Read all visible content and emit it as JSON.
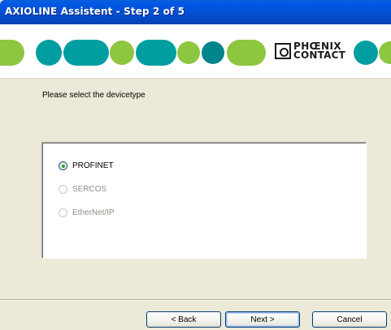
{
  "window": {
    "title": "AXIOLINE Assistent - Step 2 of 5"
  },
  "banner": {
    "logo_line1": "PHŒNIX",
    "logo_line2": "CONTACT",
    "colors": {
      "green": "#8dc63f",
      "teal": "#009ea1",
      "dark_teal": "#00868a"
    }
  },
  "content": {
    "prompt": "Please select the devicetype",
    "device_types": [
      {
        "label": "PROFINET",
        "selected": true,
        "enabled": true
      },
      {
        "label": "SERCOS",
        "selected": false,
        "enabled": false
      },
      {
        "label": "EtherNet/IP",
        "selected": false,
        "enabled": false
      }
    ]
  },
  "buttons": {
    "back": "< Back",
    "next": "Next >",
    "cancel": "Cancel"
  }
}
